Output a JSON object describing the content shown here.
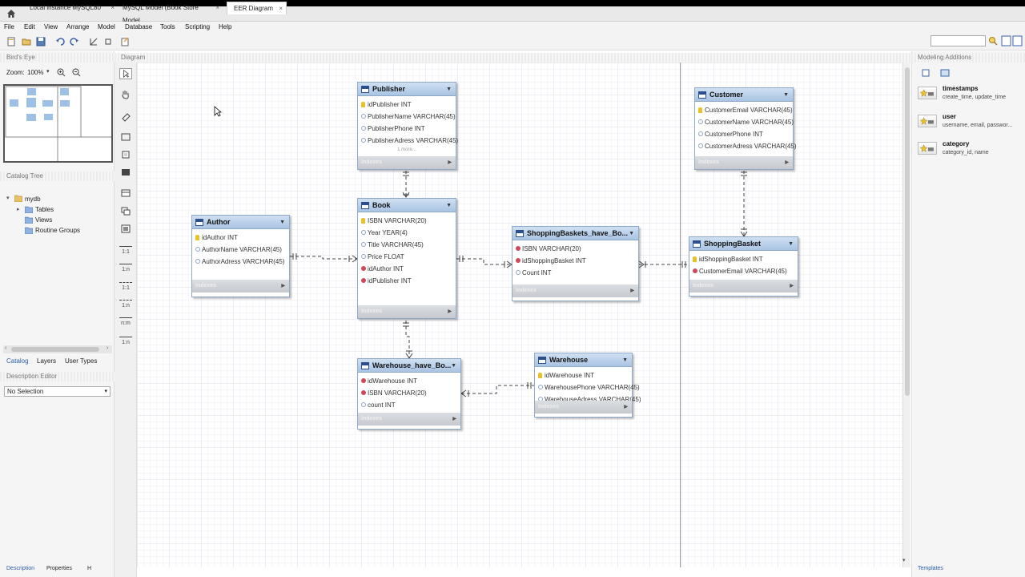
{
  "tabs": [
    {
      "label": "Local instance MySQL80",
      "close": "×"
    },
    {
      "label": "MySQL Model (Book Store Model...",
      "close": "×"
    },
    {
      "label": "EER Diagram",
      "close": "×"
    }
  ],
  "menu": [
    "File",
    "Edit",
    "View",
    "Arrange",
    "Model",
    "Database",
    "Tools",
    "Scripting",
    "Help"
  ],
  "left": {
    "birds_eye_title": "Bird's Eye",
    "zoom_label": "Zoom:",
    "zoom_value": "100%",
    "catalog_tree_title": "Catalog Tree",
    "tree": {
      "root": "mydb",
      "children": [
        "Tables",
        "Views",
        "Routine Groups"
      ]
    },
    "bottom_tabs": [
      "Catalog",
      "Layers",
      "User Types"
    ],
    "description_editor_title": "Description Editor",
    "description_select": "No Selection",
    "footer_tabs": [
      "Description",
      "Properties",
      "H"
    ]
  },
  "diagram_title": "Diagram",
  "tools": [
    "1:1",
    "1:n",
    "1:1",
    "1:n",
    "n:m",
    "1:n"
  ],
  "entities": {
    "publisher": {
      "name": "Publisher",
      "columns": [
        "idPublisher INT",
        "PublisherName VARCHAR(45)",
        "PublisherPhone INT",
        "PublisherAdress VARCHAR(45)"
      ],
      "more": "1 more...",
      "indexes": "Indexes"
    },
    "book": {
      "name": "Book",
      "columns": [
        "ISBN VARCHAR(20)",
        "Year YEAR(4)",
        "Title VARCHAR(45)",
        "Price FLOAT",
        "idAuthor INT",
        "idPublisher INT"
      ],
      "indexes": "Indexes"
    },
    "author": {
      "name": "Author",
      "columns": [
        "idAuthor INT",
        "AuthorName VARCHAR(45)",
        "AuthorAdress VARCHAR(45)"
      ],
      "indexes": "Indexes"
    },
    "shopping_baskets_have_books": {
      "name": "ShoppingBaskets_have_Bo...",
      "columns": [
        "ISBN VARCHAR(20)",
        "idShoppingBasket INT",
        "Count INT"
      ],
      "indexes": "Indexes"
    },
    "customer": {
      "name": "Customer",
      "columns": [
        "CustomerEmail VARCHAR(45)",
        "CustomerName VARCHAR(45)",
        "CustomerPhone INT",
        "CustomerAdress VARCHAR(45)"
      ],
      "indexes": "Indexes"
    },
    "shopping_basket": {
      "name": "ShoppingBasket",
      "columns": [
        "idShoppingBasket INT",
        "CustomerEmail VARCHAR(45)"
      ],
      "indexes": "Indexes"
    },
    "warehouse_have_books": {
      "name": "Warehouse_have_Bo...",
      "columns": [
        "idWarehouse INT",
        "ISBN VARCHAR(20)",
        "count INT"
      ],
      "indexes": "Indexes"
    },
    "warehouse": {
      "name": "Warehouse",
      "columns": [
        "idWarehouse INT",
        "WarehousePhone VARCHAR(45)",
        "WarehouseAdress VARCHAR(45)"
      ],
      "indexes": "Indexes"
    }
  },
  "right": {
    "title": "Modeling Additions",
    "additions": [
      {
        "title": "timestamps",
        "subtitle": "create_time, update_time"
      },
      {
        "title": "user",
        "subtitle": "username, email, passwor..."
      },
      {
        "title": "category",
        "subtitle": "category_id, name"
      }
    ],
    "footer_tab": "Templates"
  },
  "colors": {
    "entity_header": "#a9c4e2",
    "pk": "#e8c228",
    "fk": "#d0485a",
    "index_bar": "#c6cacf"
  }
}
